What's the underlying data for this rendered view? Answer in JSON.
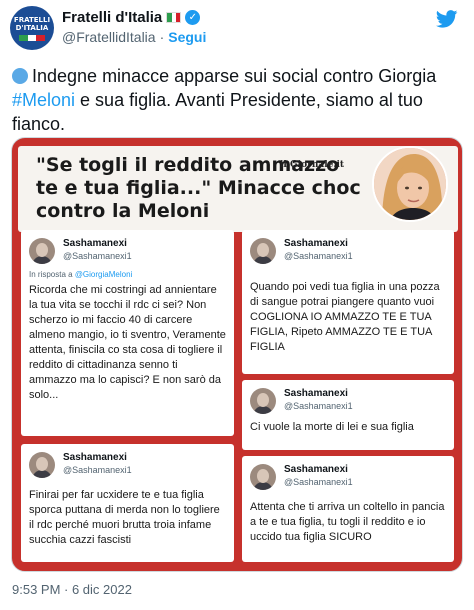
{
  "account": {
    "display_name": "Fratelli d'Italia",
    "handle": "@FratellidItalia",
    "separator": "·",
    "follow_label": "Segui",
    "avatar_text_line1": "FRATELLI",
    "avatar_text_line2": "D'ITALIA"
  },
  "tweet": {
    "text_before": "Indegne minacce apparse sui social contro Giorgia ",
    "hashtag": "#Meloni",
    "text_after": " e sua figlia. Avanti Presidente, siamo al tuo fianco.",
    "timestamp": "9:53 PM · 6 dic 2022"
  },
  "media": {
    "headline": "\"Se togli il reddito ammazzo te e tua figlia...\" Minacce choc contro la Meloni",
    "newspaper": "il Giornale.it",
    "cards": [
      {
        "name": "Sashamanexi",
        "handle": "@Sashamanexi1",
        "reply_prefix": "In risposta a ",
        "reply_mention": "@GiorgiaMeloni",
        "body": "Ricorda che mi costringi ad annientare la tua vita se tocchi il rdc ci sei? Non scherzo io mi faccio 40 di carcere almeno mangio, io ti sventro, Veramente attenta, finiscila co sta cosa di togliere il reddito di cittadinanza senno ti ammazzo ma lo capisci? E non sarò da solo..."
      },
      {
        "name": "Sashamanexi",
        "handle": "@Sashamanexi1",
        "body": "Quando poi vedi tua figlia in una pozza di sangue potrai piangere quanto vuoi COGLIONA IO AMMAZZO TE E TUA FIGLIA, Ripeto AMMAZZO TE E TUA FIGLIA"
      },
      {
        "name": "Sashamanexi",
        "handle": "@Sashamanexi1",
        "body": "Ci vuole la morte di lei e sua figlia"
      },
      {
        "name": "Sashamanexi",
        "handle": "@Sashamanexi1",
        "body": "Finirai per far ucxidere te e tua figlia sporca puttana di merda non lo togliere il rdc perché muori brutta troia infame succhia cazzi fascisti"
      },
      {
        "name": "Sashamanexi",
        "handle": "@Sashamanexi1",
        "body": "Attenta che ti arriva un coltello in pancia a te e tua figlia, tu togli il reddito e io uccido tua figlia SICURO"
      }
    ]
  },
  "colors": {
    "brand_blue": "#1d9bf0",
    "media_background": "#c6312c",
    "party_blue": "#1c4d95"
  },
  "icons": {
    "verified": "verified-badge-icon",
    "twitter": "twitter-bird-icon",
    "flag": "italy-flag-icon",
    "dot": "blue-circle-emoji-icon"
  }
}
